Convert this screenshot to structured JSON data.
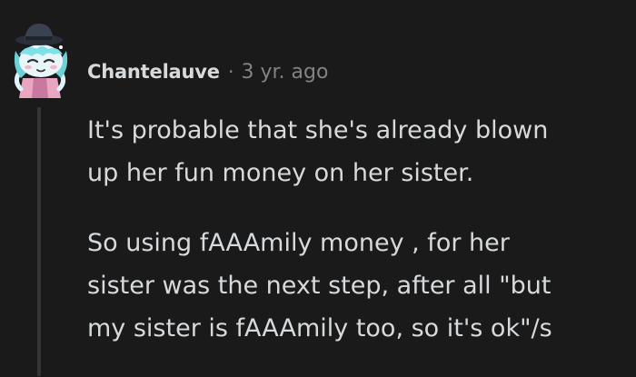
{
  "comment": {
    "author": "Chantelauve",
    "separator": "·",
    "age": "3 yr. ago",
    "avatar_icon": "snoo-avatar-icon",
    "paragraphs": [
      "It's probable that she's already blown\nup her fun money on her sister.",
      "So using fAAAmily money , for her\nsister was the next step, after all \"but\nmy sister is fAAAmily too, so it's ok\"/s"
    ]
  },
  "colors": {
    "background": "#1a1a1b",
    "text": "#d7dadc",
    "meta": "#818384",
    "thread_line": "#343536"
  }
}
